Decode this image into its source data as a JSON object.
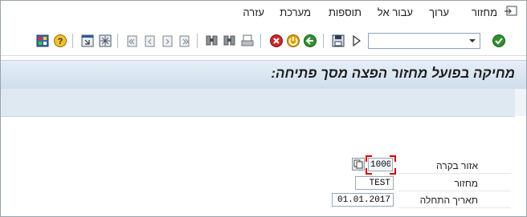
{
  "menu": {
    "items": [
      "מחזור",
      "ערוך",
      "עבור אל",
      "תוספות",
      "מערכת",
      "עזרה"
    ]
  },
  "toolbar": {
    "command_field_value": "",
    "icons": [
      "enter-icon",
      "command-dropdown-icon",
      "forward-icon",
      "save-icon",
      "back-icon",
      "exit-icon",
      "cancel-icon",
      "print-icon",
      "find-icon",
      "find-next-icon",
      "first-page-icon",
      "previous-page-icon",
      "next-page-icon",
      "last-page-icon",
      "create-session-icon",
      "create-shortcut-icon",
      "help-icon",
      "customize-layout-icon"
    ]
  },
  "page": {
    "title": "מחיקה בפועל מחזור הפצה מסך פתיחה:"
  },
  "form": {
    "fields": [
      {
        "label": "אזור בקרה",
        "value": "1000"
      },
      {
        "label": "מחזור",
        "value": "TEST"
      },
      {
        "label": "תאריך התחלה",
        "value": "01.01.2017"
      }
    ]
  },
  "colors": {
    "title_bar_top": "#e6eff7",
    "title_bar_bottom": "#cfdeec",
    "required_marker": "#d40000"
  }
}
